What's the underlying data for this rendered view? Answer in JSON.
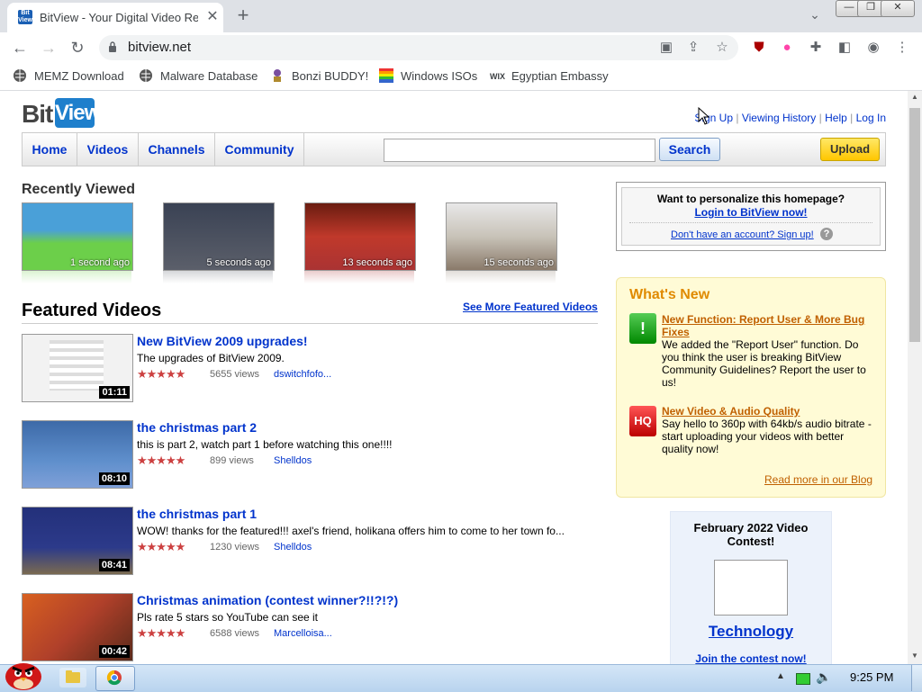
{
  "browser": {
    "tab_title": "BitView - Your Digital Video Re",
    "favicon_text": "Bit View",
    "url": "bitview.net",
    "window_buttons": [
      "—",
      "❐",
      "✕"
    ],
    "bookmarks": [
      {
        "label": "MEMZ Download",
        "icon": "globe-icon"
      },
      {
        "label": "Malware Database",
        "icon": "globe-icon"
      },
      {
        "label": "Bonzi BUDDY!",
        "icon": "bonzi-icon"
      },
      {
        "label": "Windows ISOs",
        "icon": "windows-icon"
      },
      {
        "label": "Egyptian Embassy",
        "icon": "wix-icon"
      }
    ],
    "wix_text": "WIX"
  },
  "site": {
    "logo_bit": "Bit",
    "logo_view": "View",
    "top_links": [
      "Sign Up",
      "Viewing History",
      "Help",
      "Log In"
    ],
    "separator": "|",
    "nav": [
      "Home",
      "Videos",
      "Channels",
      "Community"
    ],
    "search_label": "Search",
    "search_value": "",
    "upload_label": "Upload"
  },
  "recently_viewed": {
    "title": "Recently Viewed",
    "items": [
      {
        "time": "1 second ago",
        "color": "#4aa0d8"
      },
      {
        "time": "5 seconds ago",
        "color": "#3a4254"
      },
      {
        "time": "13 seconds ago",
        "color": "#c0392b"
      },
      {
        "time": "15 seconds ago",
        "color": "#c8c3b8"
      }
    ]
  },
  "featured": {
    "title": "Featured Videos",
    "see_more": "See More Featured Videos",
    "videos": [
      {
        "title": "New BitView 2009 upgrades!",
        "desc": "The upgrades of BitView 2009.",
        "stars": "★★★★★",
        "views": "5655 views",
        "user": "dswitchfofo...",
        "duration": "01:11",
        "color": "#f2f2f2"
      },
      {
        "title": "the christmas part 2",
        "desc": "this is part 2, watch part 1 before watching this one!!!!",
        "stars": "★★★★★",
        "views": "899 views",
        "user": "Shelldos",
        "duration": "08:10",
        "color": "#4f78b8"
      },
      {
        "title": "the christmas part 1",
        "desc": "WOW! thanks for the featured!!! axel's friend, holikana offers him to come to her town fo...",
        "stars": "★★★★★",
        "views": "1230 views",
        "user": "Shelldos",
        "duration": "08:41",
        "color": "#2c3a8a"
      },
      {
        "title": "Christmas animation (contest winner?!!?!?)",
        "desc": "Pls rate 5 stars so YouTube can see it",
        "stars": "★★★★★",
        "views": "6588 views",
        "user": "Marcelloisa...",
        "duration": "00:42",
        "color": "#b0402a"
      }
    ]
  },
  "login_box": {
    "question": "Want to personalize this homepage?",
    "login_link": "Login to BitView now!",
    "signup_link": "Don't have an account? Sign up!",
    "help_glyph": "?"
  },
  "whats_new": {
    "title": "What's New",
    "items": [
      {
        "link": "New Function: Report User & More Bug Fixes",
        "text": "We added the \"Report User\" function. Do you think the user is breaking BitView Community Guidelines? Report the user to us!",
        "icon_text": "!"
      },
      {
        "link": "New Video & Audio Quality",
        "text": "Say hello to 360p with 64kb/s audio bitrate - start uploading your videos with better quality now!",
        "icon_text": "HQ"
      }
    ],
    "blog_link": "Read more in our Blog"
  },
  "contest": {
    "title": "February 2022 Video Contest!",
    "category": "Technology",
    "join": "Join the contest now!"
  },
  "taskbar": {
    "clock": "9:25 PM"
  }
}
